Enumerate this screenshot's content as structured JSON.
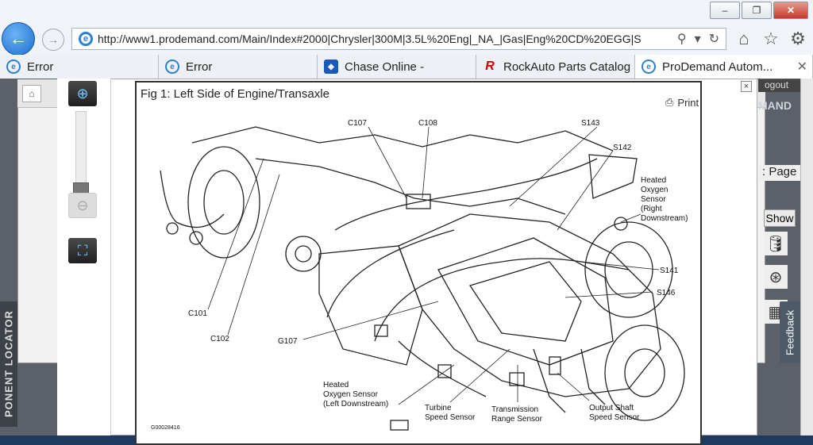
{
  "browser": {
    "window_buttons": [
      "–",
      "❐",
      "✕"
    ],
    "url": "http://www1.prodemand.com/Main/Index#2000|Chrysler|300M|3.5L%20Eng|_NA_|Gas|Eng%20CD%20EGG|S",
    "tabs": [
      {
        "label": "Error",
        "icon": "ie-icon"
      },
      {
        "label": "Error",
        "icon": "ie-icon"
      },
      {
        "label": "Chase Online -",
        "icon": "chase-icon"
      },
      {
        "label": "RockAuto Parts Catalog",
        "icon": "rockauto-icon"
      },
      {
        "label": "ProDemand Autom...",
        "icon": "ie-icon",
        "active": true
      }
    ]
  },
  "page": {
    "logout": "ogout",
    "brand": "MAND",
    "side_label": ": Page",
    "show_button": "Show",
    "feedback": "Feedback",
    "component_locator": "PONENT LOCATOR"
  },
  "figure": {
    "title": "Fig 1: Left Side of Engine/Transaxle",
    "print_label": "Print",
    "close": "×",
    "image_id": "G00028416",
    "labels": {
      "c107": "C107",
      "c108": "C108",
      "s143": "S143",
      "s142": "S142",
      "heated_rd": [
        "Heated",
        "Oxygen",
        "Sensor",
        "(Right",
        "Downstream)"
      ],
      "s141": "S141",
      "s146": "S146",
      "c101": "C101",
      "c102": "C102",
      "g107": "G107",
      "heated_ld": [
        "Heated",
        "Oxygen Sensor",
        "(Left Downstream)"
      ],
      "turbine": [
        "Turbine",
        "Speed Sensor"
      ],
      "trs": [
        "Transmission",
        "Range Sensor"
      ],
      "oss": [
        "Output Shaft",
        "Speed Sensor"
      ]
    }
  }
}
